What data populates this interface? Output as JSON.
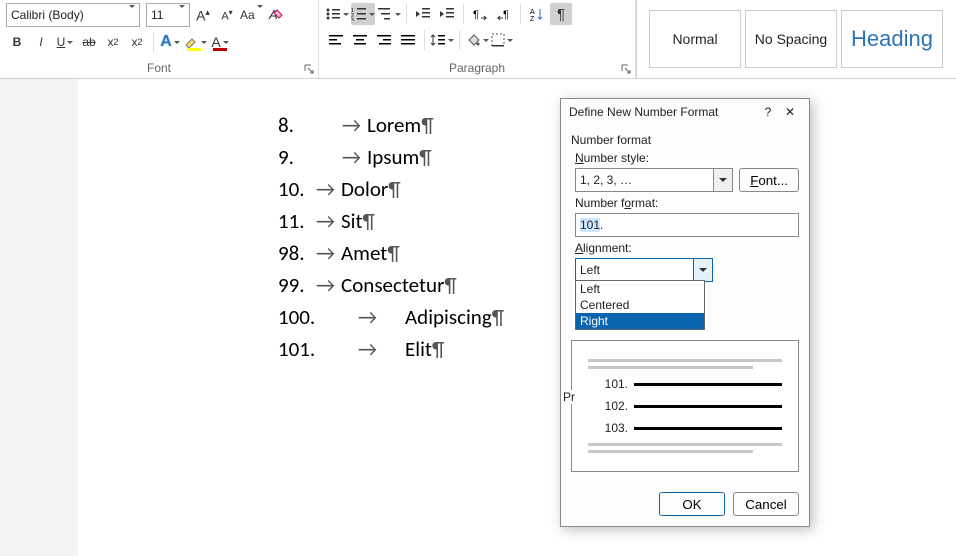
{
  "ribbon": {
    "font_name": "Calibri (Body)",
    "font_size": "11",
    "group_font": "Font",
    "group_paragraph": "Paragraph"
  },
  "styles": {
    "normal": "Normal",
    "no_spacing": "No Spacing",
    "heading": "Heading"
  },
  "doc": {
    "lines": [
      {
        "num": "8.",
        "arrow": "→",
        "text": "Lorem"
      },
      {
        "num": "9.",
        "arrow": "→",
        "text": "Ipsum"
      },
      {
        "num": "10.",
        "arrow": "→",
        "text": "Dolor",
        "tight": true
      },
      {
        "num": "11.",
        "arrow": "→",
        "text": "Sit",
        "tight": true
      },
      {
        "num": "98.",
        "arrow": "→",
        "text": "Amet",
        "tight": true
      },
      {
        "num": "99.",
        "arrow": "→",
        "text": "Consectetur",
        "tight": true
      },
      {
        "num": "100.",
        "arrow": "→",
        "text": "Adipiscing",
        "wide": true
      },
      {
        "num": "101.",
        "arrow": "→",
        "text": "Elit",
        "wide": true
      }
    ],
    "pilcrow": "¶"
  },
  "dialog": {
    "title": "Define New Number Format",
    "help": "?",
    "close": "✕",
    "section": "Number format",
    "lbl_style": "Number style:",
    "style_value": "1, 2, 3, …",
    "font_btn": "Font...",
    "lbl_format": "Number format:",
    "format_value_sel": "101",
    "format_value_rest": ".",
    "lbl_align": "Alignment:",
    "align_value": "Left",
    "align_options": {
      "left": "Left",
      "centered": "Centered",
      "right": "Right"
    },
    "preview_label_hidden": "Pr",
    "preview": [
      "101.",
      "102.",
      "103."
    ],
    "ok": "OK",
    "cancel": "Cancel"
  },
  "chart_data": null
}
